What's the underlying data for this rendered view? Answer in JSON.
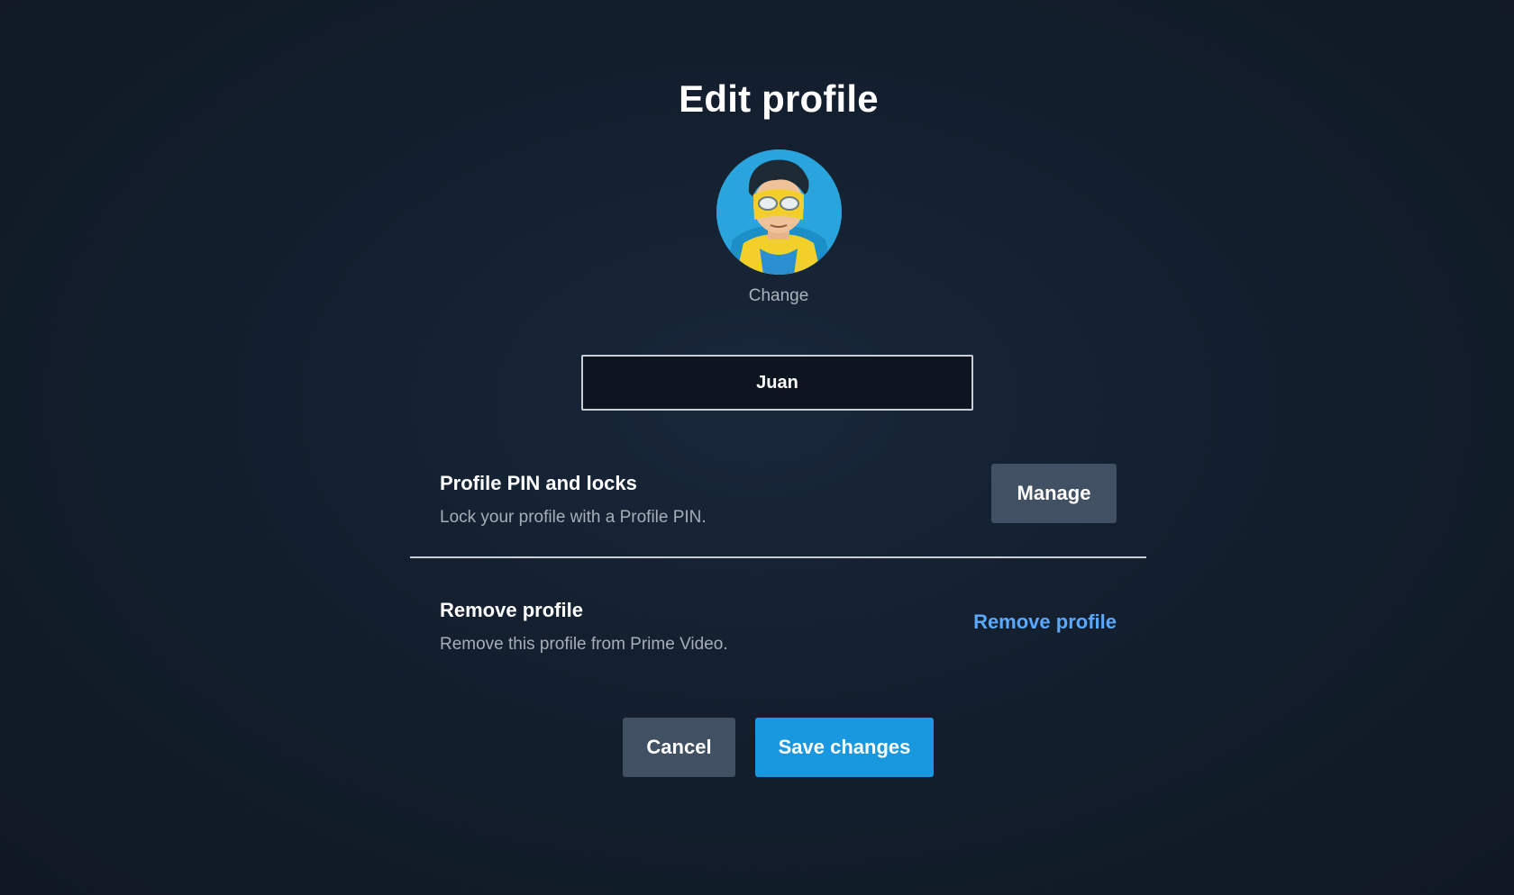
{
  "page": {
    "title": "Edit profile"
  },
  "avatar": {
    "icon": "cartoon-hero-avatar-icon",
    "change_label": "Change"
  },
  "name_field": {
    "value": "Juan"
  },
  "pin_locks": {
    "title": "Profile PIN and locks",
    "description": "Lock your profile with a Profile PIN.",
    "button_label": "Manage"
  },
  "remove_profile": {
    "title": "Remove profile",
    "description": "Remove this profile from Prime Video.",
    "link_label": "Remove profile"
  },
  "actions": {
    "cancel_label": "Cancel",
    "save_label": "Save changes"
  },
  "colors": {
    "background": "#131f2e",
    "primary_button": "#1a98df",
    "secondary_button": "#425063",
    "link": "#5aa9ff"
  }
}
